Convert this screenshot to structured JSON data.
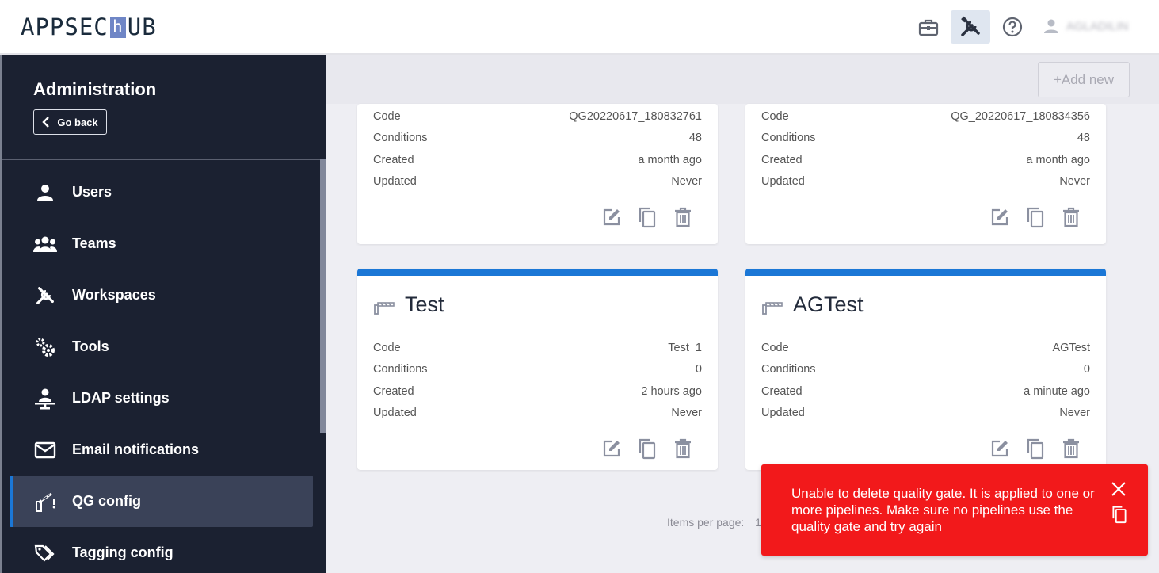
{
  "header": {
    "logo_left": "APPSEC",
    "logo_h": "h",
    "logo_right": "UB",
    "icons": [
      "briefcase-icon",
      "tools-icon",
      "help-icon",
      "user-icon"
    ],
    "username": "AGLADILIN"
  },
  "sidebar": {
    "title": "Administration",
    "go_back_label": "Go back",
    "items": [
      {
        "label": "Users",
        "icon": "user-icon"
      },
      {
        "label": "Teams",
        "icon": "team-icon"
      },
      {
        "label": "Workspaces",
        "icon": "tools-icon"
      },
      {
        "label": "Tools",
        "icon": "gears-icon"
      },
      {
        "label": "LDAP settings",
        "icon": "ldap-icon"
      },
      {
        "label": "Email notifications",
        "icon": "mail-icon"
      },
      {
        "label": "QG config",
        "icon": "gate-icon",
        "active": true
      },
      {
        "label": "Tagging config",
        "icon": "tags-icon"
      }
    ]
  },
  "main": {
    "add_new_label": "+Add new",
    "cards": [
      {
        "title": "",
        "rows": [
          {
            "label": "Code",
            "value": "QG20220617_180832761"
          },
          {
            "label": "Conditions",
            "value": "48"
          },
          {
            "label": "Created",
            "value": "a month ago"
          },
          {
            "label": "Updated",
            "value": "Never"
          }
        ]
      },
      {
        "title": "",
        "rows": [
          {
            "label": "Code",
            "value": "QG_20220617_180834356"
          },
          {
            "label": "Conditions",
            "value": "48"
          },
          {
            "label": "Created",
            "value": "a month ago"
          },
          {
            "label": "Updated",
            "value": "Never"
          }
        ]
      },
      {
        "title": "Test",
        "rows": [
          {
            "label": "Code",
            "value": "Test_1"
          },
          {
            "label": "Conditions",
            "value": "0"
          },
          {
            "label": "Created",
            "value": "2 hours ago"
          },
          {
            "label": "Updated",
            "value": "Never"
          }
        ]
      },
      {
        "title": "AGTest",
        "rows": [
          {
            "label": "Code",
            "value": "AGTest"
          },
          {
            "label": "Conditions",
            "value": "0"
          },
          {
            "label": "Created",
            "value": "a minute ago"
          },
          {
            "label": "Updated",
            "value": "Never"
          }
        ]
      }
    ],
    "pagination": {
      "items_per_page_label": "Items per page:",
      "items_per_page_value": "12"
    }
  },
  "toast": {
    "message": "Unable to delete quality gate. It is applied to one or more pipelines. Make sure no pipelines use the quality gate and try again",
    "color": "#f2191b"
  },
  "colors": {
    "accent": "#1b77d6",
    "sidebar_bg": "#1b2131",
    "sidebar_active": "#3a4258"
  }
}
